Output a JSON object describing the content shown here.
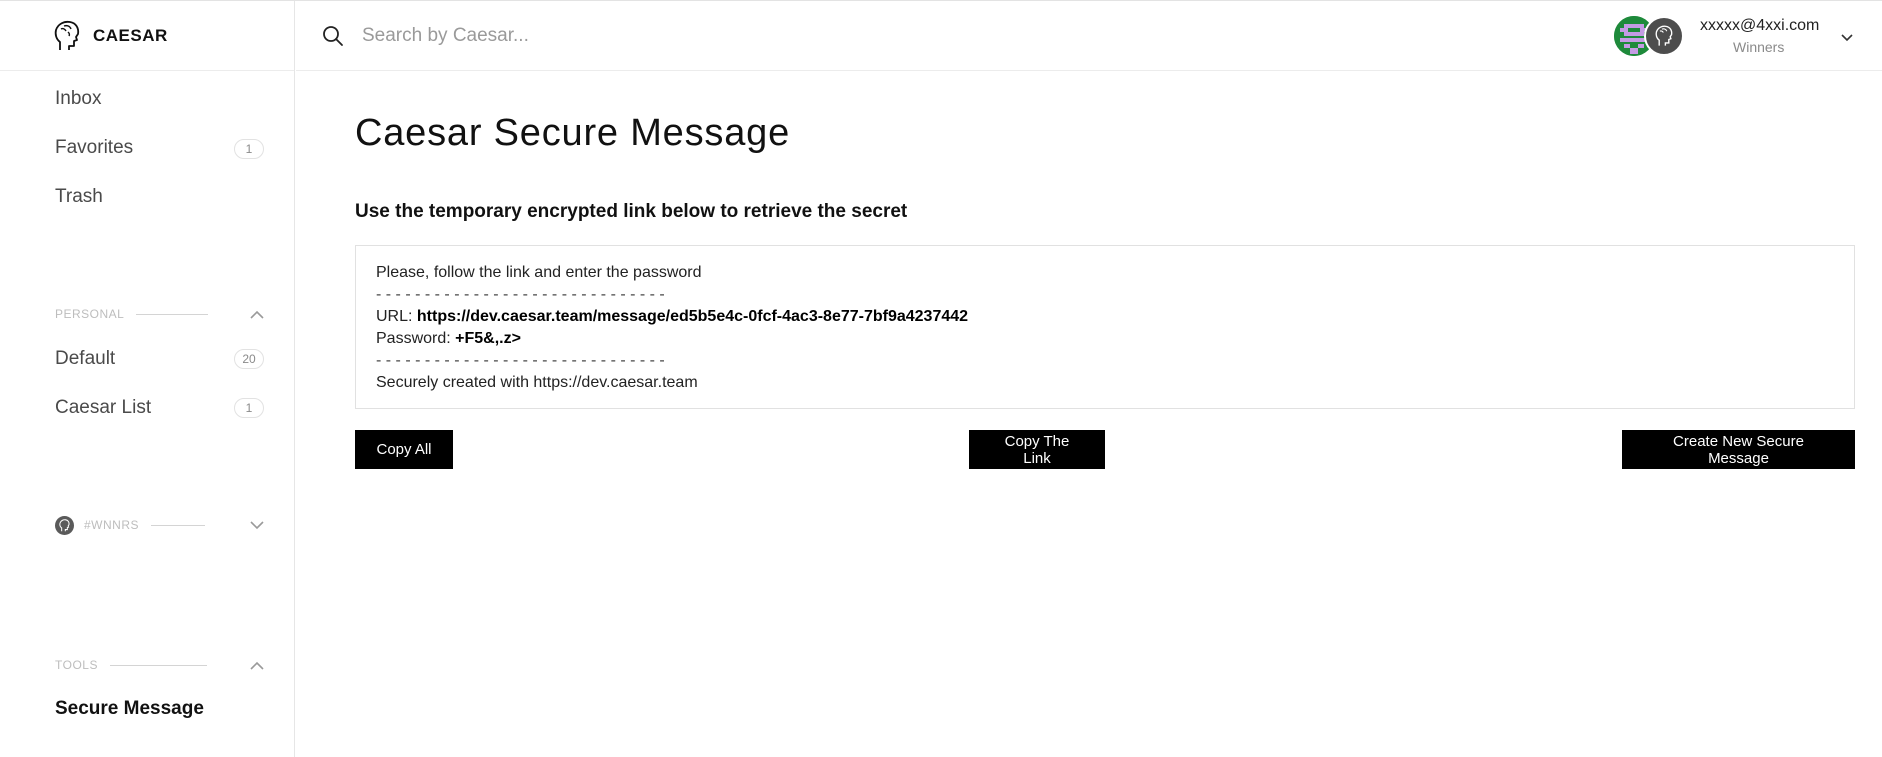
{
  "app": {
    "name": "CAESAR"
  },
  "sidebar": {
    "items": [
      {
        "label": "Inbox"
      },
      {
        "label": "Favorites",
        "count": "1"
      },
      {
        "label": "Trash"
      }
    ],
    "personal": {
      "label": "PERSONAL",
      "lists": [
        {
          "label": "Default",
          "count": "20"
        },
        {
          "label": "Caesar List",
          "count": "1"
        }
      ]
    },
    "team": {
      "label": "#WNNRS"
    },
    "tools": {
      "label": "TOOLS",
      "items": [
        {
          "label": "Secure Message"
        }
      ]
    }
  },
  "header": {
    "search": {
      "placeholder": "Search by Caesar..."
    },
    "user": {
      "email": "xxxxx@4xxi.com",
      "team": "Winners"
    }
  },
  "main": {
    "title": "Caesar Secure Message",
    "subtitle": "Use the temporary encrypted link below to retrieve the secret",
    "message": {
      "intro": "Please, follow the link and enter the password",
      "separator": "- - - - - - - - - - - - - - - - - - - - - - - - - - - - - -",
      "url_label": "URL:",
      "url": "https://dev.caesar.team/message/ed5b5e4c-0fcf-4ac3-8e77-7bf9a4237442",
      "password_label": "Password:",
      "password": "+F5&,.z>",
      "footer": "Securely created with https://dev.caesar.team"
    },
    "buttons": {
      "copy_all": "Copy All",
      "copy_link": "Copy The Link",
      "create_new": "Create New Secure Message"
    }
  },
  "colors": {
    "primary_button": "#000000",
    "sidebar_border": "#e6e6e6",
    "avatar_green": "#1e8a3b",
    "avatar_purple": "#c39be3"
  }
}
